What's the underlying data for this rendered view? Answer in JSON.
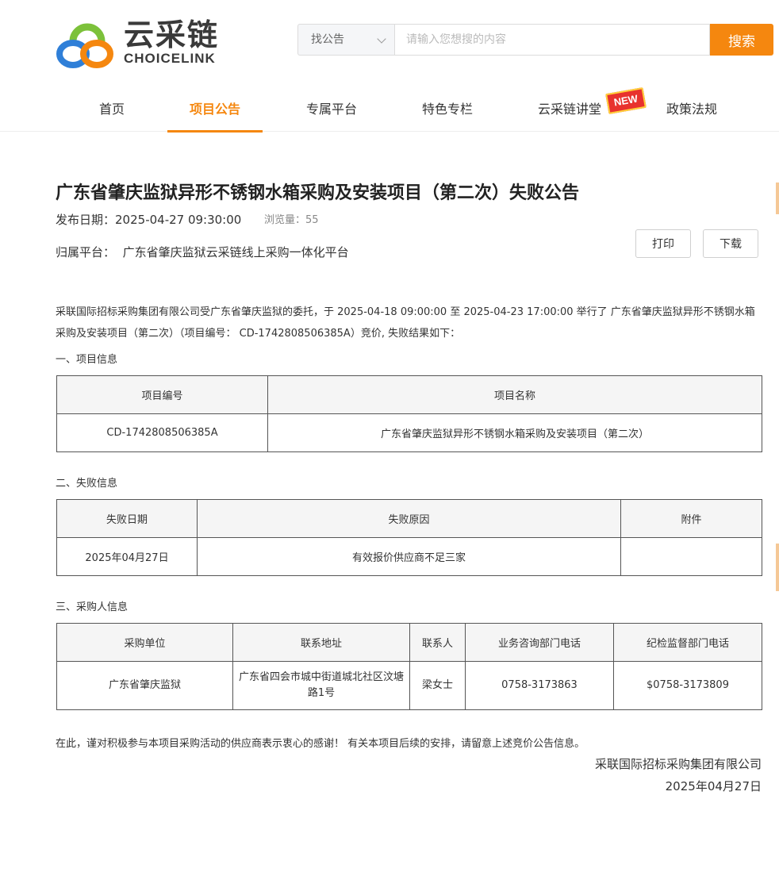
{
  "logo": {
    "cn": "云采链",
    "en": "CHOICELINK"
  },
  "search": {
    "select_label": "找公告",
    "placeholder": "请输入您想搜的内容",
    "button": "搜索"
  },
  "nav": {
    "items": [
      "首页",
      "项目公告",
      "专属平台",
      "特色专栏",
      "云采链讲堂",
      "政策法规"
    ],
    "active": "项目公告",
    "badge": "NEW"
  },
  "article": {
    "title": "广东省肇庆监狱异形不锈钢水箱采购及安装项目（第二次）失败公告",
    "publish_label": "发布日期：",
    "publish_date": "2025-04-27 09:30:00",
    "views_label": "浏览量：",
    "views": "55",
    "platform_label": "归属平台：",
    "platform": "广东省肇庆监狱云采链线上采购一体化平台",
    "print": "打印",
    "download": "下载",
    "intro": "采联国际招标采购集团有限公司受广东省肇庆监狱的委托，于 2025-04-18 09:00:00 至 2025-04-23 17:00:00 举行了 广东省肇庆监狱异形不锈钢水箱采购及安装项目（第二次）（项目编号： CD-1742808506385A）竞价, 失败结果如下："
  },
  "section1": {
    "label": "一、项目信息",
    "headers": [
      "项目编号",
      "项目名称"
    ],
    "row": [
      "CD-1742808506385A",
      "广东省肇庆监狱异形不锈钢水箱采购及安装项目（第二次）"
    ]
  },
  "section2": {
    "label": "二、失败信息",
    "headers": [
      "失败日期",
      "失败原因",
      "附件"
    ],
    "row": [
      "2025年04月27日",
      "有效报价供应商不足三家",
      ""
    ]
  },
  "section3": {
    "label": "三、采购人信息",
    "headers": [
      "采购单位",
      "联系地址",
      "联系人",
      "业务咨询部门电话",
      "纪检监督部门电话"
    ],
    "row": [
      "广东省肇庆监狱",
      "广东省四会市城中街道城北社区汶塘路1号",
      "梁女士",
      "0758-3173863",
      "$0758-3173809"
    ]
  },
  "closing": "在此，谨对积极参与本项目采购活动的供应商表示衷心的感谢！ 有关本项目后续的安排，请留意上述竞价公告信息。",
  "signature": {
    "org": "采联国际招标采购集团有限公司",
    "date": "2025年04月27日"
  },
  "colors": {
    "accent": "#f5870f",
    "badge": "#e8322e"
  }
}
